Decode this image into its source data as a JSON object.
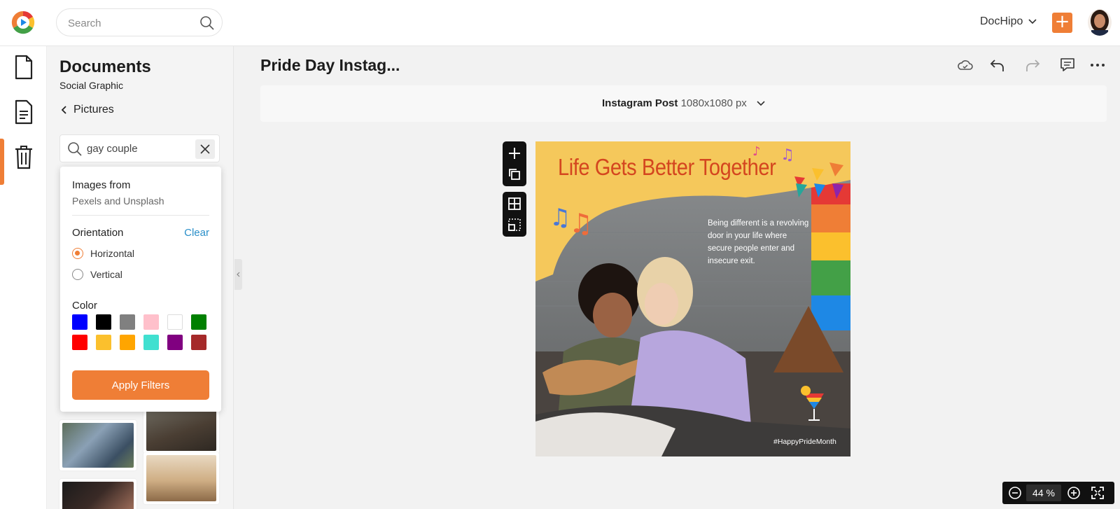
{
  "header": {
    "search_placeholder": "Search",
    "workspace": "DocHipo",
    "add_label": "+"
  },
  "panel": {
    "title": "Documents",
    "subtitle": "Social Graphic",
    "back_label": "Pictures",
    "search_value": "gay couple"
  },
  "filter": {
    "source_heading": "Images from",
    "source_value": "Pexels and Unsplash",
    "orientation_heading": "Orientation",
    "clear_label": "Clear",
    "orientations": [
      {
        "label": "Horizontal",
        "selected": true
      },
      {
        "label": "Vertical",
        "selected": false
      }
    ],
    "color_heading": "Color",
    "colors": [
      "#0000ff",
      "#000000",
      "#808080",
      "#ffc0cb",
      "#ffffff",
      "#008000",
      "#ff0000",
      "#fbc02d",
      "#ffa500",
      "#40e0d0",
      "#800080",
      "#a52a2a"
    ],
    "apply_label": "Apply Filters"
  },
  "main": {
    "doc_title": "Pride Day Instag...",
    "size_name": "Instagram Post",
    "size_dims": "1080x1080 px"
  },
  "design": {
    "headline": "Life Gets Better Together",
    "body": "Being different is a revolving door in your life where secure people enter and insecure exit.",
    "hashtag": "#HappyPrideMonth"
  },
  "zoom": {
    "value": "44",
    "unit": "%"
  },
  "colors": {
    "accent": "#ef7e36",
    "link": "#2a8fc9",
    "headline": "#d4461f",
    "banner_yellow": "#f5c85b"
  }
}
